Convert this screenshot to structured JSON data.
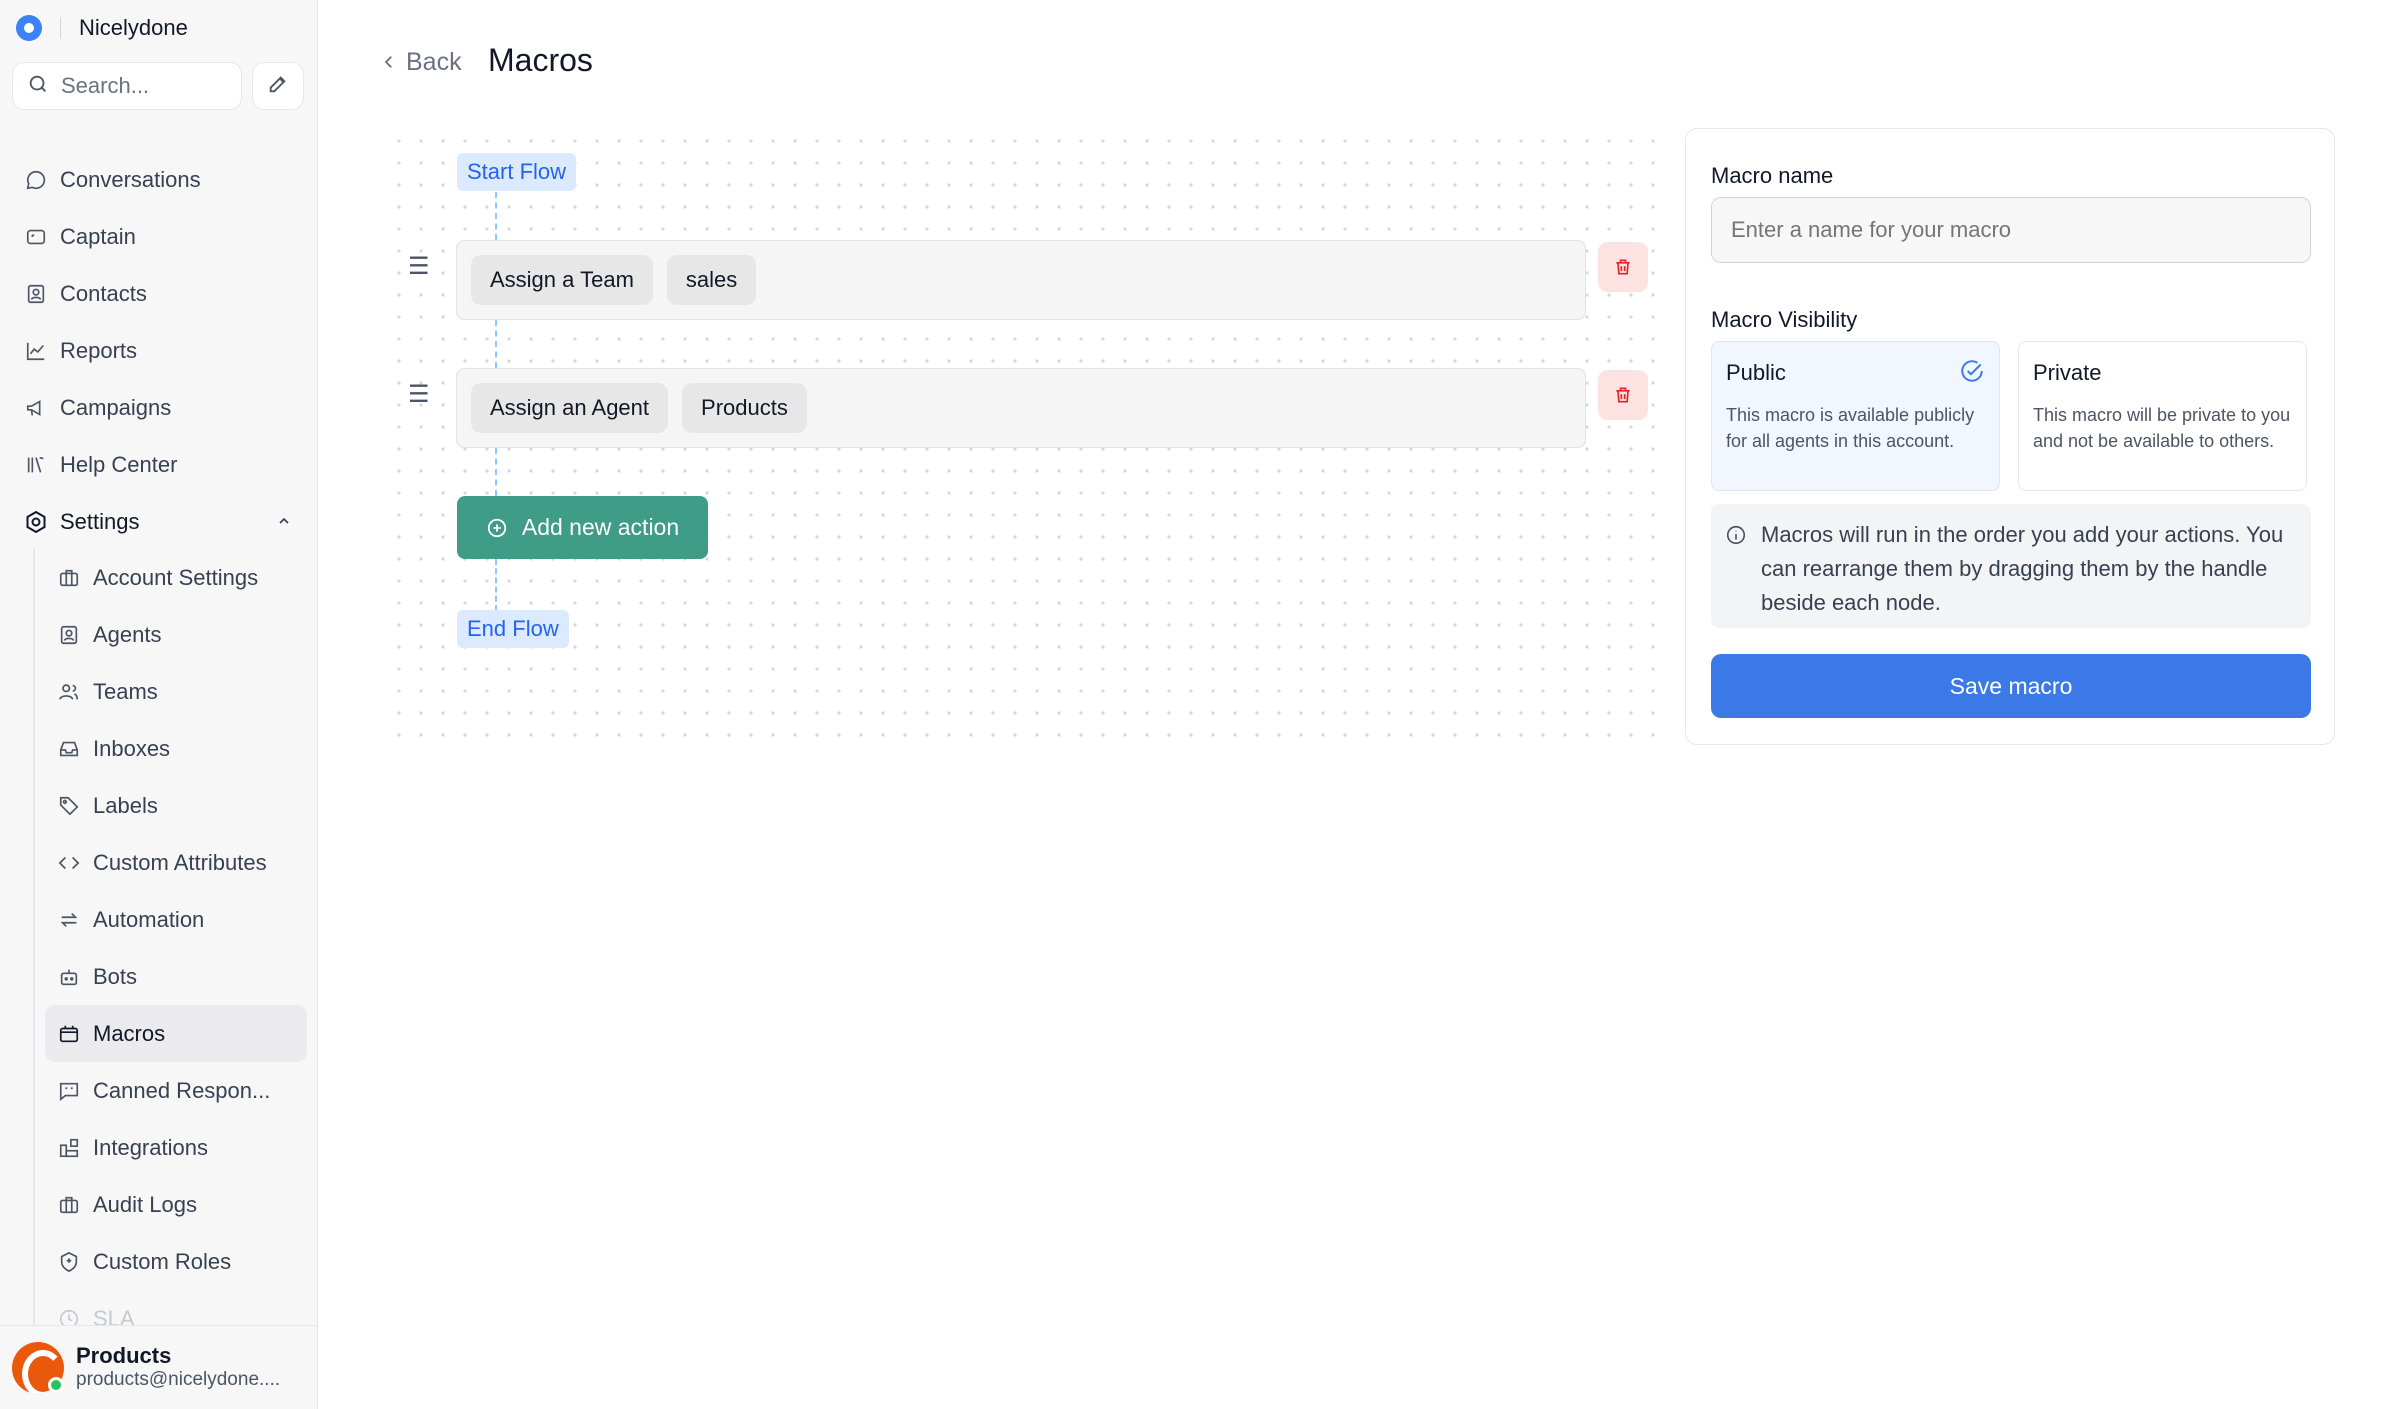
{
  "sidebar": {
    "brand": "Nicelydone",
    "search_placeholder": "Search...",
    "items": [
      {
        "label": "Conversations",
        "icon": "chat-bubble-icon"
      },
      {
        "label": "Captain",
        "icon": "captain-icon"
      },
      {
        "label": "Contacts",
        "icon": "contacts-icon"
      },
      {
        "label": "Reports",
        "icon": "reports-icon"
      },
      {
        "label": "Campaigns",
        "icon": "megaphone-icon"
      },
      {
        "label": "Help Center",
        "icon": "library-icon"
      },
      {
        "label": "Settings",
        "icon": "settings-icon"
      }
    ],
    "settings_items": [
      {
        "label": "Account Settings",
        "icon": "briefcase-icon"
      },
      {
        "label": "Agents",
        "icon": "agent-icon"
      },
      {
        "label": "Teams",
        "icon": "teams-icon"
      },
      {
        "label": "Inboxes",
        "icon": "inbox-icon"
      },
      {
        "label": "Labels",
        "icon": "tag-icon"
      },
      {
        "label": "Custom Attributes",
        "icon": "code-icon"
      },
      {
        "label": "Automation",
        "icon": "automation-icon"
      },
      {
        "label": "Bots",
        "icon": "bot-icon"
      },
      {
        "label": "Macros",
        "icon": "macro-icon",
        "active": true
      },
      {
        "label": "Canned Respon...",
        "icon": "canned-response-icon"
      },
      {
        "label": "Integrations",
        "icon": "integrations-icon"
      },
      {
        "label": "Audit Logs",
        "icon": "audit-log-icon"
      },
      {
        "label": "Custom Roles",
        "icon": "shield-icon"
      },
      {
        "label": "SLA",
        "icon": "sla-icon"
      }
    ],
    "profile": {
      "name": "Products",
      "email": "products@nicelydone...."
    }
  },
  "header": {
    "back_label": "Back",
    "title": "Macros"
  },
  "flow": {
    "start_label": "Start Flow",
    "end_label": "End Flow",
    "actions": [
      {
        "action": "Assign a Team",
        "value": "sales"
      },
      {
        "action": "Assign an Agent",
        "value": "Products"
      }
    ],
    "add_action_label": "Add new action"
  },
  "panel": {
    "name_label": "Macro name",
    "name_placeholder": "Enter a name for your macro",
    "name_value": "",
    "visibility_label": "Macro Visibility",
    "visibility_options": [
      {
        "title": "Public",
        "description": "This macro is available publicly for all agents in this account.",
        "selected": true
      },
      {
        "title": "Private",
        "description": "This macro will be private to you and not be available to others.",
        "selected": false
      }
    ],
    "info_text": "Macros will run in the order you add your actions. You can rearrange them by dragging them by the handle beside each node.",
    "save_label": "Save macro"
  },
  "colors": {
    "primary": "#3b79e7",
    "add_action": "#3f9c86",
    "flow_tag_bg": "#dbeafe",
    "flow_tag_text": "#2563eb",
    "delete_bg": "#fde2e2",
    "delete_icon": "#dc2626"
  }
}
